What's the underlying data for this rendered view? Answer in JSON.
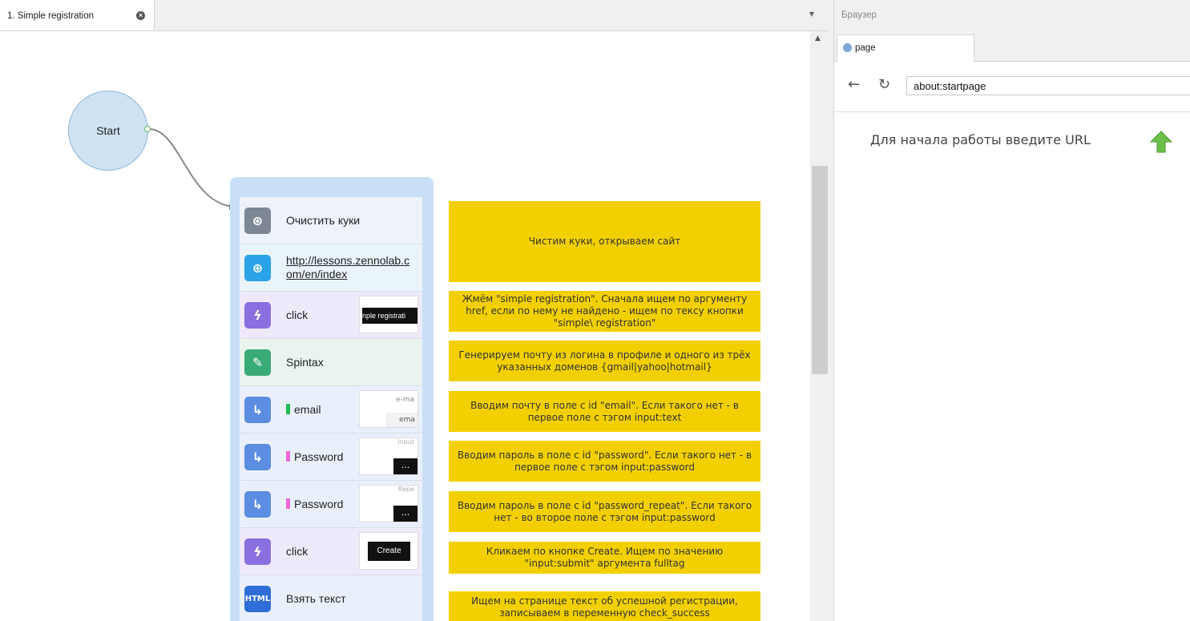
{
  "editor": {
    "tab_label": "1. Simple registration",
    "start_label": "Start",
    "actions": [
      {
        "label": "Очистить куки",
        "icon": "cookie-icon",
        "color": "#7d8694"
      },
      {
        "label": "http://lessons.zennolab.com/en/index",
        "icon": "globe-icon",
        "color": "#2aa3e8"
      },
      {
        "label": "click",
        "icon": "lightning-icon",
        "color": "#8a6fe0",
        "thumb": "nple registrati"
      },
      {
        "label": "Spintax",
        "icon": "pencil-icon",
        "color": "#3aaa77"
      },
      {
        "label": "email",
        "icon": "arrow-corner-icon",
        "color": "#5b8de0",
        "tag_color": "#22bb55",
        "thumb_top": "e-ma",
        "thumb_bottom": "ema"
      },
      {
        "label": "Password",
        "icon": "arrow-corner-icon",
        "color": "#5b8de0",
        "tag_color": "#ee66dd",
        "thumb_top": "input",
        "thumb_bottom": "..."
      },
      {
        "label": "Password",
        "icon": "arrow-corner-icon",
        "color": "#5b8de0",
        "tag_color": "#ee66dd",
        "thumb_top": "Repe",
        "thumb_bottom": "..."
      },
      {
        "label": "click",
        "icon": "lightning-icon",
        "color": "#8a6fe0",
        "thumb": "Create"
      },
      {
        "label": "Взять текст",
        "icon": "html-icon",
        "icon_text": "HTML",
        "color": "#2f6ed8"
      }
    ],
    "notes": [
      "Чистим куки, открываем сайт",
      "Жмём \"simple registration\". Сначала ищем по аргументу href, если по нему не найдено - ищем по тексу кнопки \"simple\\ registration\"",
      "Генерируем почту из логина в профиле и одного из трёх указанных доменов {gmail|yahoo|hotmail}",
      "Вводим почту в поле с id \"email\". Если такого нет - в первое поле с тэгом input:text",
      "Вводим пароль в поле с id \"password\". Если такого нет - в первое поле с тэгом input:password",
      "Вводим пароль в поле с id \"password_repeat\". Если такого нет - во второе поле с тэгом input:password",
      "Кликаем по кнопке Create. Ищем по значению \"input:submit\" аргумента fulltag",
      "Ищем на странице текст об успешной регистрации, записываем в переменную check_success"
    ]
  },
  "browser": {
    "title": "Браузер",
    "tab_label": "page",
    "url": "about:startpage",
    "start_message": "Для начала работы введите URL"
  }
}
